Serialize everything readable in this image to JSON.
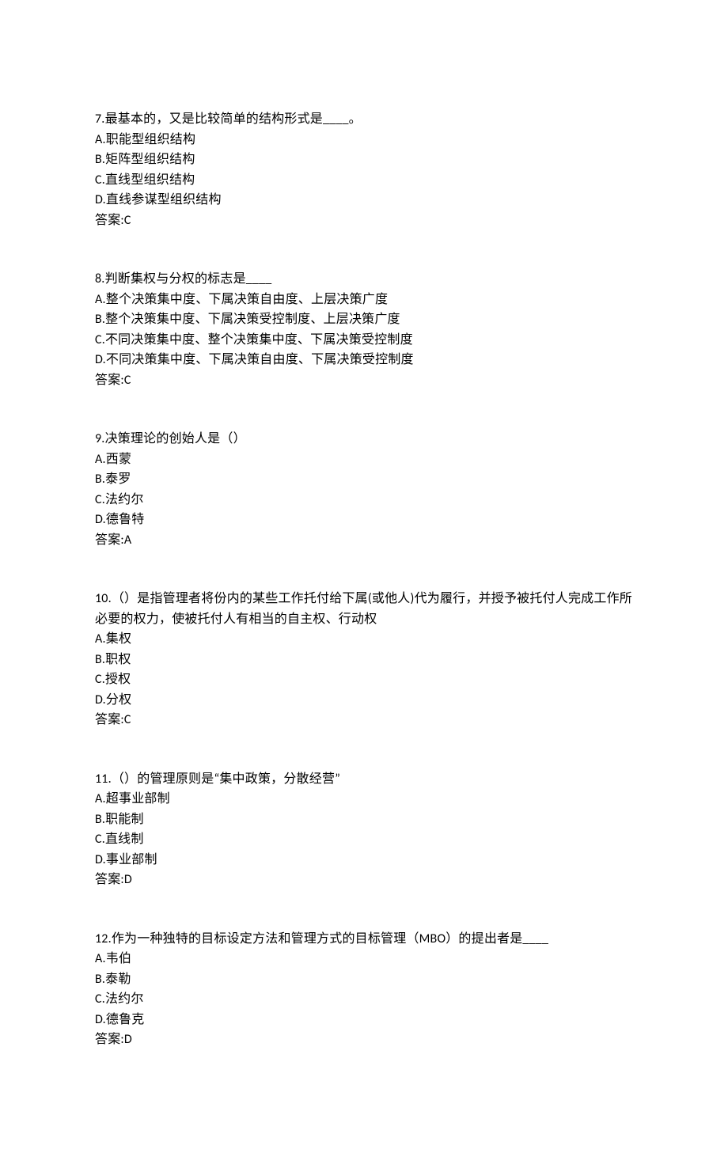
{
  "questions": [
    {
      "num": "7.",
      "stem": "最基本的，又是比较简单的结构形式是____。",
      "options": [
        "A.职能型组织结构",
        "B.矩阵型组织结构",
        "C.直线型组织结构",
        "D.直线参谋型组织结构"
      ],
      "answer": "答案:C"
    },
    {
      "num": "8.",
      "stem": "判断集权与分权的标志是____",
      "options": [
        "A.整个决策集中度、下属决策自由度、上层决策广度",
        "B.整个决策集中度、下属决策受控制度、上层决策广度",
        "C.不同决策集中度、整个决策集中度、下属决策受控制度",
        "D.不同决策集中度、下属决策自由度、下属决策受控制度"
      ],
      "answer": "答案:C"
    },
    {
      "num": "9.",
      "stem": "决策理论的创始人是（）",
      "options": [
        "A.西蒙",
        "B.泰罗",
        "C.法约尔",
        "D.德鲁特"
      ],
      "answer": "答案:A"
    },
    {
      "num": "10.",
      "stem": "（）是指管理者将份内的某些工作托付给下属(或他人)代为履行，并授予被托付人完成工作所必要的权力，使被托付人有相当的自主权、行动权",
      "options": [
        "A.集权",
        "B.职权",
        "C.授权",
        "D.分权"
      ],
      "answer": "答案:C"
    },
    {
      "num": "11.",
      "stem": "（）的管理原则是“集中政策，分散经营”",
      "options": [
        "A.超事业部制",
        "B.职能制",
        "C.直线制",
        "D.事业部制"
      ],
      "answer": "答案:D"
    },
    {
      "num": "12.",
      "stem": "作为一种独特的目标设定方法和管理方式的目标管理（MBO）的提出者是____",
      "options": [
        "A.韦伯",
        "B.泰勒",
        "C.法约尔",
        "D.德鲁克"
      ],
      "answer": "答案:D"
    }
  ]
}
